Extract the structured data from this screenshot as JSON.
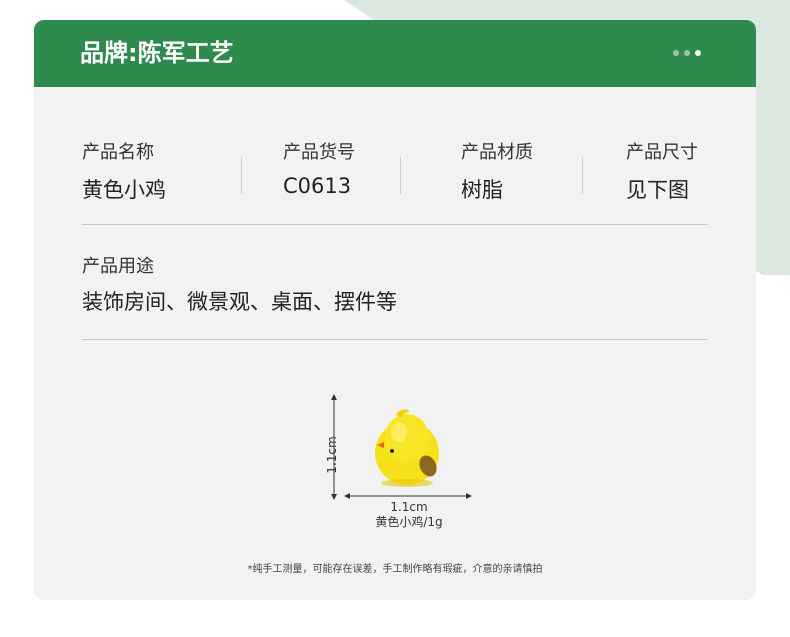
{
  "brand_title": "品牌:陈军工艺",
  "specs": [
    {
      "label": "产品名称",
      "value": "黄色小鸡"
    },
    {
      "label": "产品货号",
      "value": "C0613"
    },
    {
      "label": "产品材质",
      "value": "树脂"
    },
    {
      "label": "产品尺寸",
      "value": "见下图"
    }
  ],
  "usage": {
    "label": "产品用途",
    "value": "装饰房间、微景观、桌面、摆件等"
  },
  "product": {
    "width_label": "1.1cm",
    "height_label": "1.1cm",
    "caption": "黄色小鸡/1g"
  },
  "footnote": "*纯手工测量，可能存在误差，手工制作略有瑕疵，介意的亲请慎拍",
  "colors": {
    "header": "#2e8a4d",
    "chick": "#f7e11b",
    "card": "#f2f2f2"
  },
  "pager": {
    "count": 3,
    "active": 3
  }
}
